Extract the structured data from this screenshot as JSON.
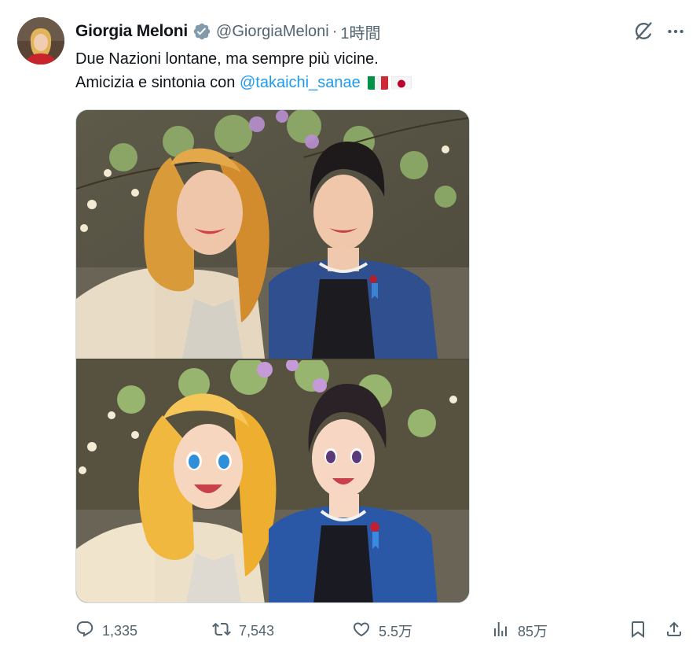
{
  "author": {
    "name": "Giorgia Meloni",
    "handle": "@GiorgiaMeloni",
    "separator": "·",
    "time": "1時間"
  },
  "tweet": {
    "line1": "Due Nazioni lontane, ma sempre più vicine.",
    "line2_prefix": "Amicizia e sintonia con ",
    "mention": "@takaichi_sanae"
  },
  "colors": {
    "link": "#1d9bf0",
    "secondary_text": "#536471",
    "verified": "#829aab"
  },
  "icons": {
    "verified": "verified-badge-icon",
    "grok": "grok-icon",
    "more": "more-icon",
    "reply": "reply-icon",
    "retweet": "retweet-icon",
    "like": "like-icon",
    "views": "views-icon",
    "bookmark": "bookmark-icon",
    "share": "share-icon"
  },
  "stats": {
    "replies": "1,335",
    "retweets": "7,543",
    "likes": "5.5万",
    "views": "85万"
  }
}
